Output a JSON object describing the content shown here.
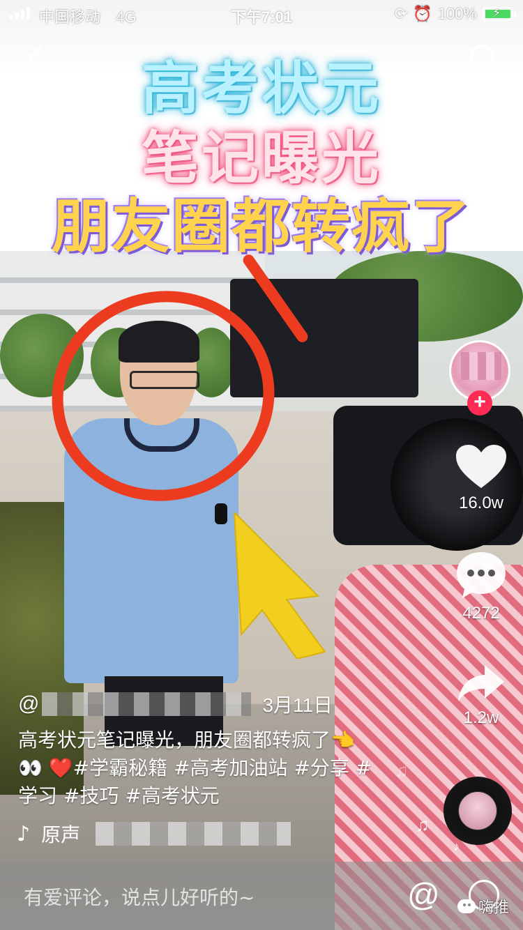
{
  "status_bar": {
    "carrier": "中国移动",
    "network": "4G",
    "time": "下午7:01",
    "battery": "100%",
    "battery_level": 1.0
  },
  "nav": {
    "back_icon": "chevron-left-icon",
    "search_icon": "search-icon"
  },
  "video_title": {
    "line1": "高考状元",
    "line2": "笔记曝光",
    "line3": "朋友圈都转疯了"
  },
  "actions": {
    "follow_label": "+",
    "likes": "16.0w",
    "comments": "4272",
    "shares": "1.2w"
  },
  "post": {
    "author_prefix": "@",
    "date": "3月11日",
    "caption_line1": "高考状元笔记曝光，朋友圈都转疯了👈",
    "caption_emoji": "👀",
    "caption_heart": "❤️",
    "caption_tags1": "#学霸秘籍 #高考加油站 #分享 #",
    "caption_line3": "学习 #技巧 #高考状元",
    "music_label": "原声"
  },
  "comment_bar": {
    "placeholder": "有爱评论，说点儿好听的~",
    "at_symbol": "@"
  },
  "watermark": "嗨推",
  "colors": {
    "follow_red": "#fe2c55",
    "battery_green": "#4cd964",
    "circle_red": "#ec3b1f",
    "arrow_yellow": "#f2cf1f"
  }
}
